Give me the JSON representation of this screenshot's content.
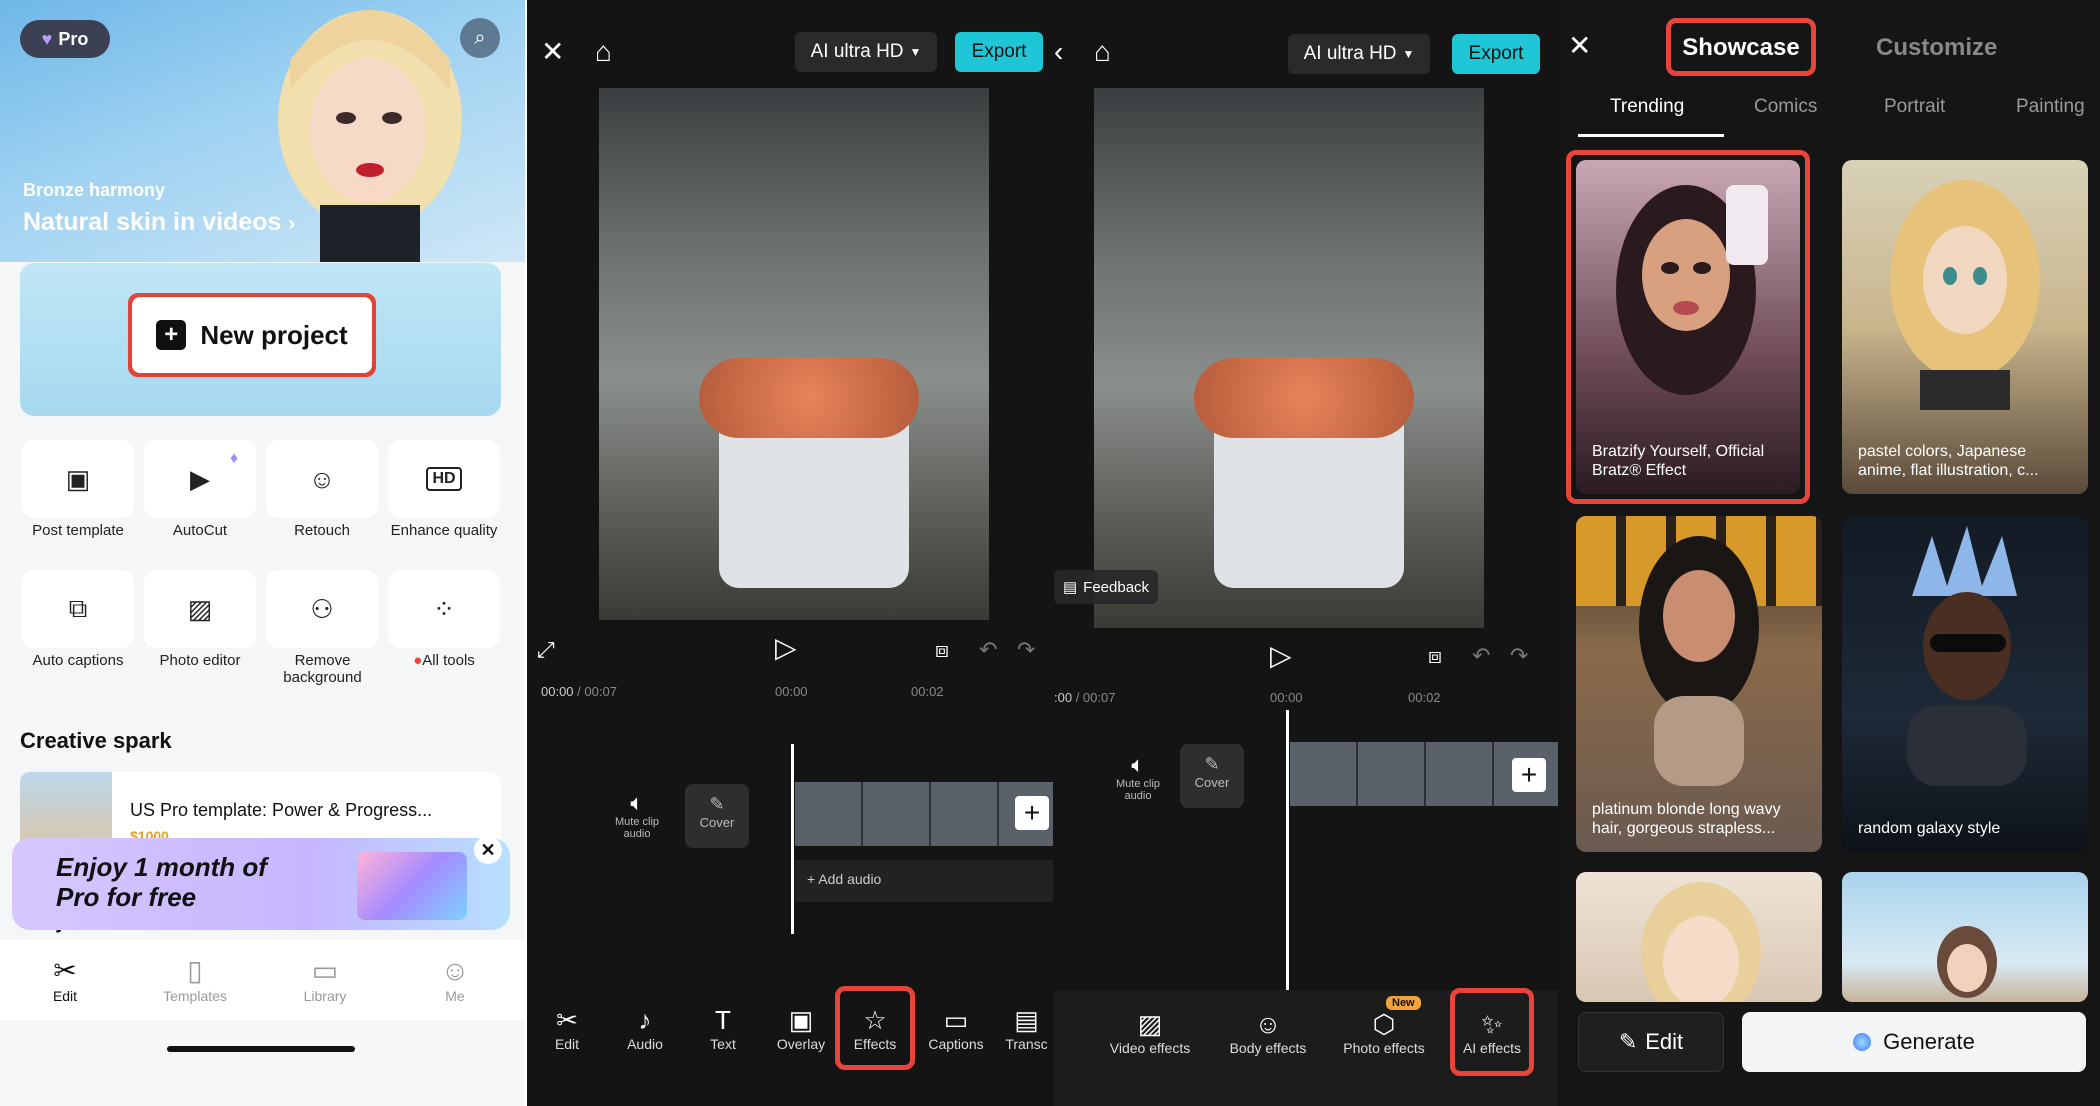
{
  "panel1": {
    "pro_badge": "Pro",
    "hero": {
      "subtitle": "Bronze harmony",
      "title": "Natural skin in videos"
    },
    "new_project": "New project",
    "tools": [
      {
        "label": "Post template",
        "icon": "post-template-icon"
      },
      {
        "label": "AutoCut",
        "icon": "autocut-icon"
      },
      {
        "label": "Retouch",
        "icon": "retouch-icon"
      },
      {
        "label": "Enhance quality",
        "icon": "hd-icon"
      },
      {
        "label": "Auto captions",
        "icon": "auto-captions-icon"
      },
      {
        "label": "Photo editor",
        "icon": "photo-editor-icon"
      },
      {
        "label": "Remove background",
        "icon": "remove-background-icon"
      },
      {
        "label": "All tools",
        "icon": "grid-icon"
      }
    ],
    "creative_spark": "Creative spark",
    "spark_item": {
      "title": "US Pro template: Power & Progress...",
      "price": "$1000"
    },
    "promo": "Enjoy 1 month of Pro for free",
    "projects_label": "Projects",
    "nav": [
      "Edit",
      "Templates",
      "Library",
      "Me"
    ]
  },
  "panel2": {
    "quality": "AI ultra HD",
    "export": "Export",
    "time_current": "00:00",
    "time_total": "00:07",
    "ticks": [
      "00:00",
      "00:02"
    ],
    "mute_clip": "Mute clip audio",
    "cover": "Cover",
    "add_audio": "+ Add audio",
    "toolbar": [
      "Edit",
      "Audio",
      "Text",
      "Overlay",
      "Effects",
      "Captions",
      "Transc"
    ]
  },
  "panel3": {
    "quality": "AI ultra HD",
    "export": "Export",
    "time_current": ":00",
    "time_total": "00:07",
    "ticks": [
      "00:00",
      "00:02"
    ],
    "feedback": "Feedback",
    "mute_clip": "Mute clip audio",
    "cover": "Cover",
    "toolbar": [
      "Video effects",
      "Body effects",
      "Photo effects",
      "AI effects"
    ],
    "new_badge": "New"
  },
  "panel4": {
    "tabs": [
      "Showcase",
      "Customize"
    ],
    "subtabs": [
      "Trending",
      "Comics",
      "Portrait",
      "Painting"
    ],
    "cards": [
      "Bratzify Yourself, Official Bratz® Effect",
      "pastel colors, Japanese anime, flat illustration, c...",
      "platinum blonde long wavy hair, gorgeous strapless...",
      "random galaxy style"
    ],
    "edit": "Edit",
    "generate": "Generate"
  },
  "colors": {
    "accent": "#1fc6d6",
    "highlight": "#e8443a",
    "dark_bg": "#141414"
  }
}
